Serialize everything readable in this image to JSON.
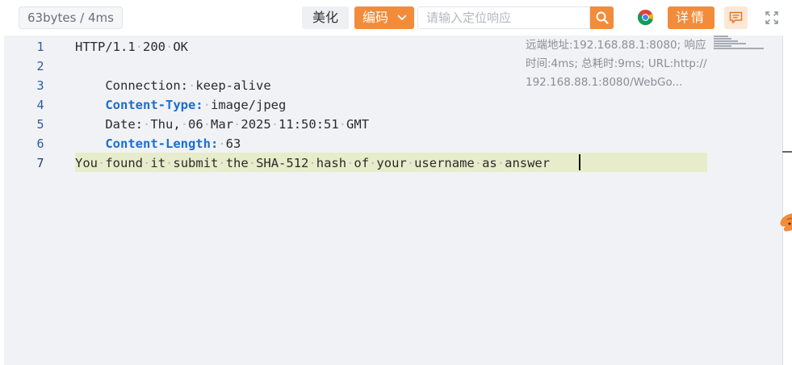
{
  "toolbar": {
    "size_label": "63bytes / 4ms",
    "beautify_label": "美化",
    "encode_label": "编码",
    "search_placeholder": "请输入定位响应",
    "search_value": "",
    "detail_label": "详情",
    "icons": {
      "encode_dropdown": "chevron-down-icon",
      "search": "search-icon",
      "browser": "chrome-icon",
      "comment": "comment-icon",
      "expand": "expand-icon"
    }
  },
  "editor": {
    "lines": [
      {
        "num": "1",
        "text": "HTTP/1.1 200 OK"
      },
      {
        "num": "2",
        "key": "Connection:",
        "value": "keep-alive",
        "bold": false
      },
      {
        "num": "3",
        "key": "Content-Type:",
        "value": "image/jpeg",
        "bold": true
      },
      {
        "num": "4",
        "key": "Date:",
        "value": "Thu, 06 Mar 2025 11:50:51 GMT",
        "bold": false
      },
      {
        "num": "5",
        "key": "Content-Length:",
        "value": "63",
        "bold": true
      },
      {
        "num": "6",
        "text": ""
      },
      {
        "num": "7",
        "text": "You found it submit the SHA-512 hash of your username as answer"
      }
    ],
    "active_line": 7,
    "info": "远端地址:192.168.88.1:8080; 响应时间:4ms; 总耗时:9ms; URL:http://192.168.88.1:8080/WebGo..."
  },
  "colors": {
    "accent": "#f28c3a",
    "header_key": "#1a6fd0",
    "editor_bg": "#f1f2f5",
    "active_line_bg": "#e7ecca"
  }
}
